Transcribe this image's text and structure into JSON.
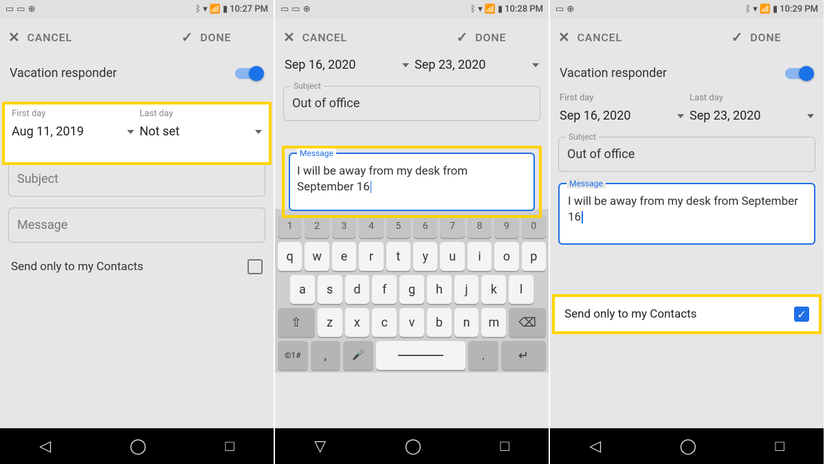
{
  "screens": [
    {
      "status": {
        "time": "10:27 PM"
      },
      "cancel": "CANCEL",
      "done": "DONE",
      "title": "Vacation responder",
      "first_day_label": "First day",
      "first_day_value": "Aug 11, 2019",
      "last_day_label": "Last day",
      "last_day_value": "Not set",
      "subject_placeholder": "Subject",
      "message_placeholder": "Message",
      "contacts_label": "Send only to my Contacts"
    },
    {
      "status": {
        "time": "10:28 PM"
      },
      "cancel": "CANCEL",
      "done": "DONE",
      "first_day_value": "Sep 16, 2020",
      "last_day_value": "Sep 23, 2020",
      "subject_label": "Subject",
      "subject_value": "Out of office",
      "message_label": "Message",
      "message_value": "I will be away from my desk from September 16",
      "keyboard": {
        "row_num": [
          "1",
          "2",
          "3",
          "4",
          "5",
          "6",
          "7",
          "8",
          "9",
          "0"
        ],
        "row1": [
          "q",
          "w",
          "e",
          "r",
          "t",
          "y",
          "u",
          "i",
          "o",
          "p"
        ],
        "row2": [
          "a",
          "s",
          "d",
          "f",
          "g",
          "h",
          "j",
          "k",
          "l"
        ],
        "row3": [
          "z",
          "x",
          "c",
          "v",
          "b",
          "n",
          "m"
        ],
        "shift": "⇧",
        "backspace": "⌫",
        "sym": "©1#",
        "comma": ",",
        "mic": "🎤",
        "space": " ",
        "period": ".",
        "enter": "↵"
      }
    },
    {
      "status": {
        "time": "10:29 PM"
      },
      "cancel": "CANCEL",
      "done": "DONE",
      "title": "Vacation responder",
      "first_day_label": "First day",
      "first_day_value": "Sep 16, 2020",
      "last_day_label": "Last day",
      "last_day_value": "Sep 23, 2020",
      "subject_label": "Subject",
      "subject_value": "Out of office",
      "message_label": "Message",
      "message_value": "I will be away from my desk from September 16",
      "contacts_label": "Send only to my Contacts"
    }
  ]
}
